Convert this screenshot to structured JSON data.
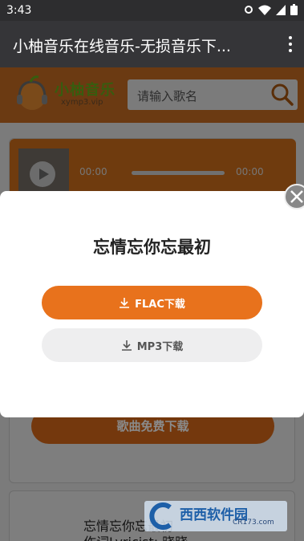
{
  "status": {
    "time": "3:43"
  },
  "appbar": {
    "title": "小柚音乐在线音乐-无损音乐下..."
  },
  "site": {
    "logo_text": "小柚音乐",
    "logo_url": "xymp3.vip",
    "search_placeholder": "请输入歌名"
  },
  "player": {
    "current_time": "00:00",
    "duration": "00:00"
  },
  "card": {
    "free_download": "歌曲免费下载"
  },
  "lyrics": {
    "title": "忘情忘你忘最初",
    "line": "作词Lyricist: 晓晓"
  },
  "dialog": {
    "title": "忘情忘你忘最初",
    "flac": "FLAC下载",
    "mp3": "MP3下载"
  },
  "watermark": {
    "brand": "西西软件园",
    "url": "CR173.com"
  },
  "colors": {
    "accent": "#e8721c",
    "appbar": "#353538"
  }
}
